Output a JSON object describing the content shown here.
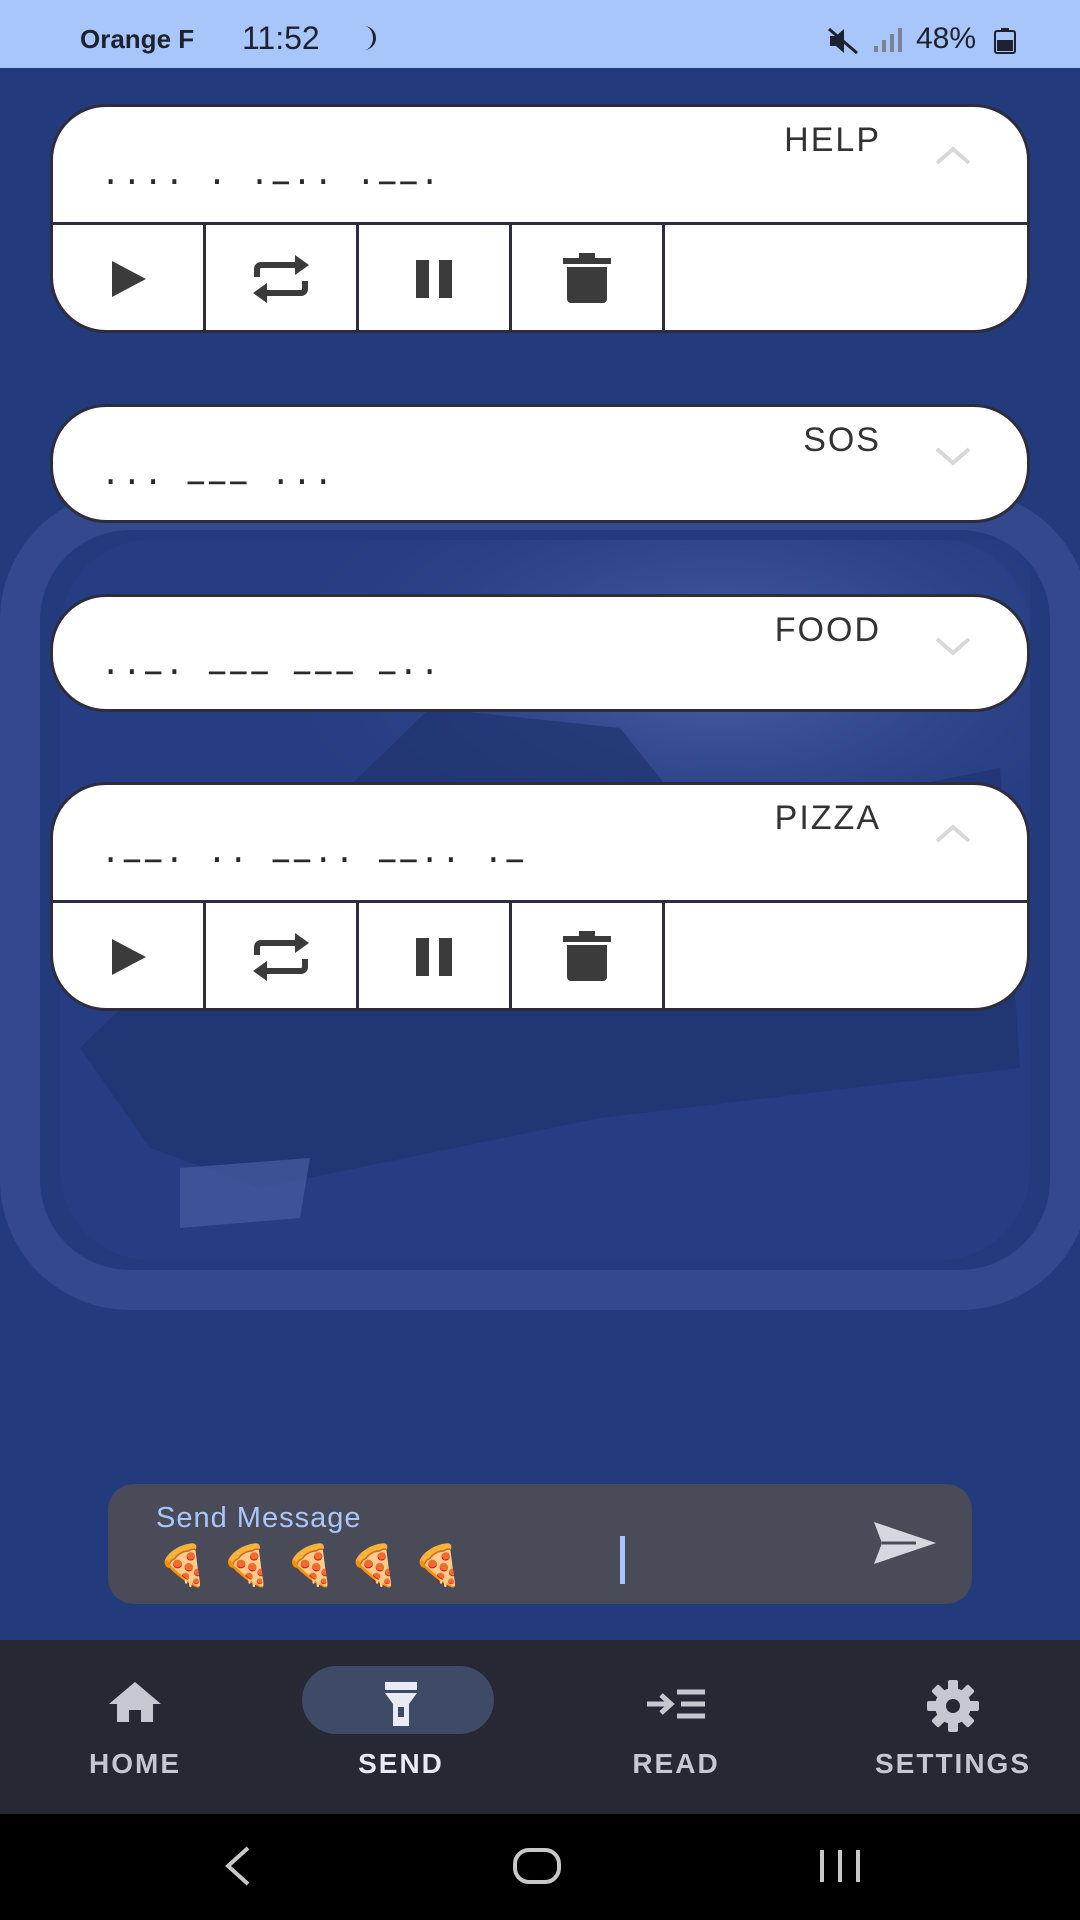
{
  "status_bar": {
    "carrier": "Orange F",
    "time": "11:52",
    "battery": "48%",
    "icons": [
      "moon-icon",
      "mute-icon",
      "signal-icon",
      "battery-icon"
    ]
  },
  "messages": [
    {
      "title": "HELP",
      "morse": "···· · ·−·· ·−−·",
      "expanded": true
    },
    {
      "title": "SOS",
      "morse": "··· −−− ···",
      "expanded": false
    },
    {
      "title": "FOOD",
      "morse": "··−· −−− −−− −··",
      "expanded": false
    },
    {
      "title": "PIZZA",
      "morse": "·−−· ·· −−·· −−·· ·−",
      "expanded": true
    }
  ],
  "controls": [
    "play-icon",
    "repeat-icon",
    "pause-icon",
    "delete-icon"
  ],
  "send": {
    "label": "Send Message",
    "value": "🍕🍕🍕🍕🍕"
  },
  "nav": {
    "items": [
      {
        "label": "HOME",
        "icon": "home-icon"
      },
      {
        "label": "SEND",
        "icon": "flashlight-icon",
        "active": true
      },
      {
        "label": "READ",
        "icon": "read-icon"
      },
      {
        "label": "SETTINGS",
        "icon": "gear-icon"
      }
    ]
  },
  "colors": {
    "background": "#233a7d",
    "status_bar": "#a9c6fb",
    "card": "#ffffff",
    "nav_bar": "#262833",
    "nav_active_pill": "#3e4a66",
    "send_box": "#4a4b58"
  }
}
